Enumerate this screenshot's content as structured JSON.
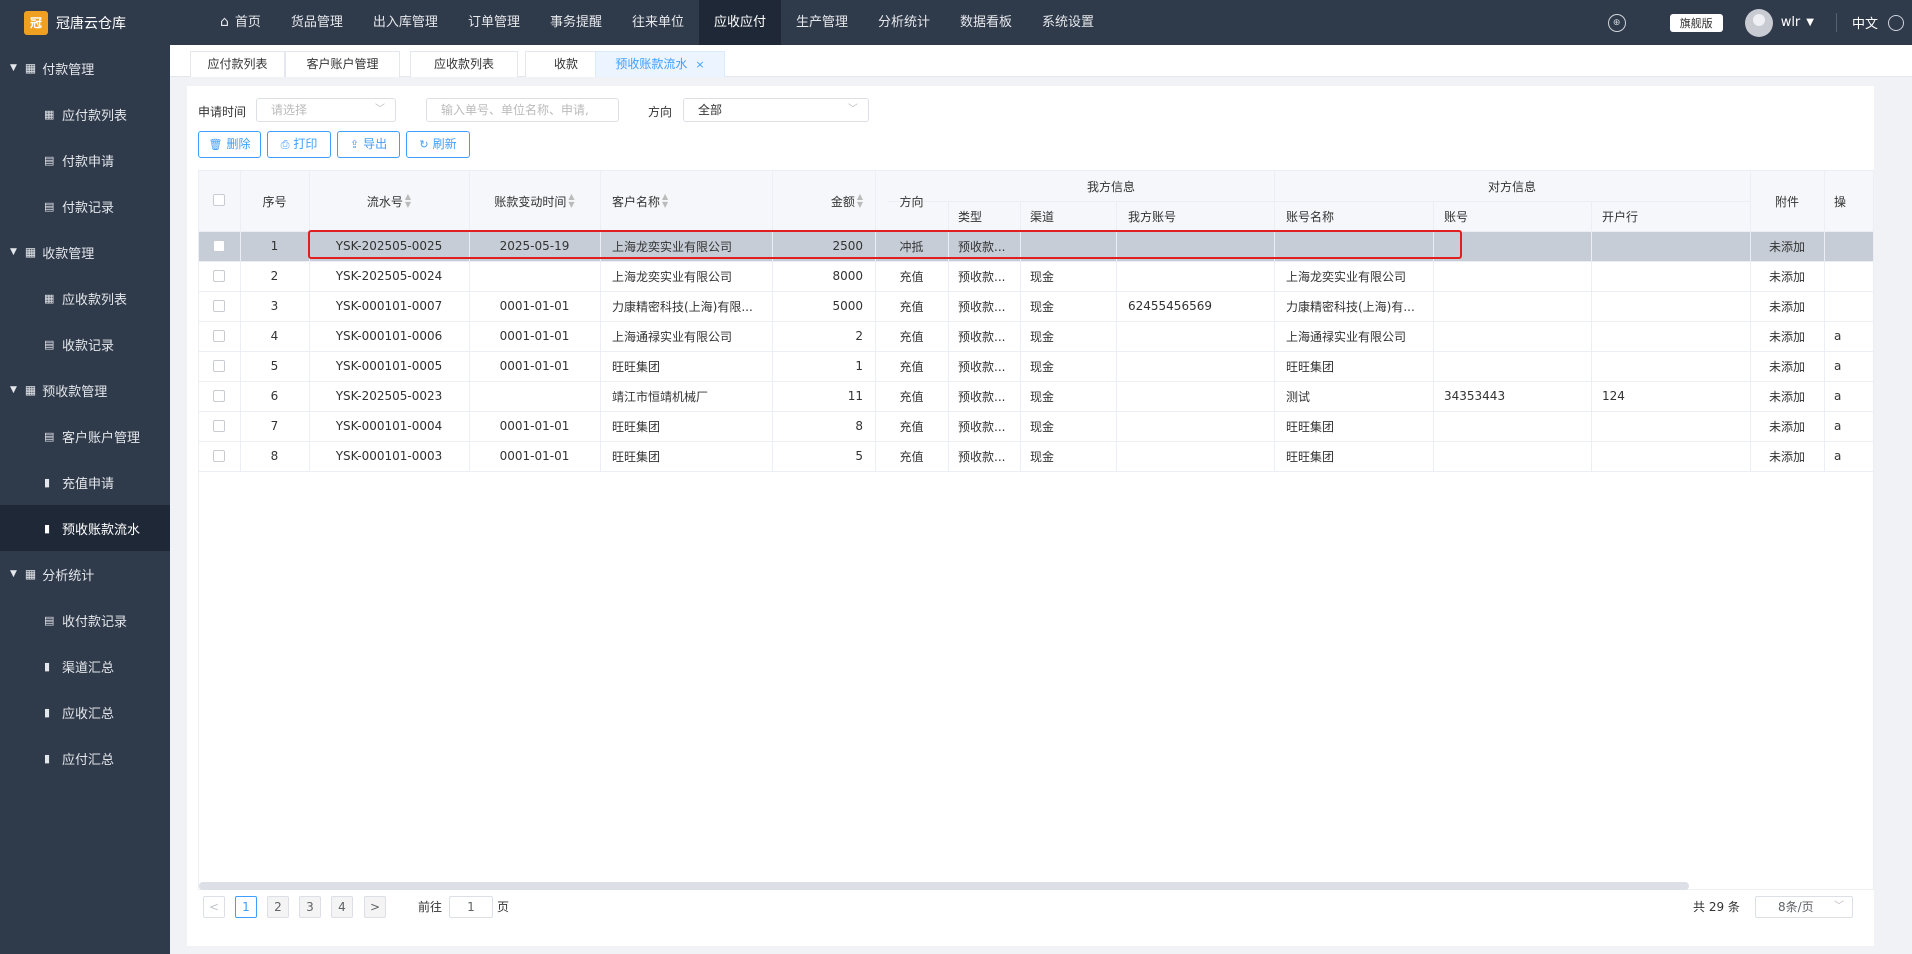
{
  "app": {
    "logo_text": "冠唐云仓库",
    "logo_mark": "冠"
  },
  "topnav": {
    "items": [
      {
        "label": "首页"
      },
      {
        "label": "货品管理"
      },
      {
        "label": "出入库管理"
      },
      {
        "label": "订单管理"
      },
      {
        "label": "事务提醒"
      },
      {
        "label": "往来单位"
      },
      {
        "label": "应收应付"
      },
      {
        "label": "生产管理"
      },
      {
        "label": "分析统计"
      },
      {
        "label": "数据看板"
      },
      {
        "label": "系统设置"
      }
    ],
    "active": "应收应付"
  },
  "header_right": {
    "edition": "旗舰版",
    "username": "wlr",
    "language": "中文"
  },
  "sidebar": {
    "groups": [
      {
        "label": "付款管理",
        "items": [
          {
            "label": "应付款列表",
            "icon": "grid-icon"
          },
          {
            "label": "付款申请",
            "icon": "document-icon"
          },
          {
            "label": "付款记录",
            "icon": "document-icon"
          }
        ]
      },
      {
        "label": "收款管理",
        "items": [
          {
            "label": "应收款列表",
            "icon": "grid-icon"
          },
          {
            "label": "收款记录",
            "icon": "document-icon"
          }
        ]
      },
      {
        "label": "预收款管理",
        "items": [
          {
            "label": "客户账户管理",
            "icon": "document-icon"
          },
          {
            "label": "充值申请",
            "icon": "bar-chart-icon"
          },
          {
            "label": "预收账款流水",
            "icon": "bar-chart-icon"
          }
        ]
      },
      {
        "label": "分析统计",
        "items": [
          {
            "label": "收付款记录",
            "icon": "document-icon"
          },
          {
            "label": "渠道汇总",
            "icon": "bar-chart-icon"
          },
          {
            "label": "应收汇总",
            "icon": "bar-chart-icon"
          },
          {
            "label": "应付汇总",
            "icon": "bar-chart-icon"
          }
        ]
      }
    ],
    "active_item": "预收账款流水"
  },
  "tabs": [
    {
      "label": "应付款列表"
    },
    {
      "label": "客户账户管理"
    },
    {
      "label": "应收款列表"
    },
    {
      "label": "收款"
    },
    {
      "label": "预收账款流水",
      "active": true,
      "close": "×"
    }
  ],
  "filters": {
    "apply_time_label": "申请时间",
    "apply_time_placeholder": "请选择",
    "search_placeholder": "输入单号、单位名称、申请,",
    "direction_label": "方向",
    "direction_value": "全部"
  },
  "toolbar": {
    "delete": "删除",
    "print": "打印",
    "export": "导出",
    "refresh": "刷新"
  },
  "table": {
    "headers": {
      "seq": "序号",
      "serial": "流水号",
      "change_time": "账款变动时间",
      "customer": "客户名称",
      "amount": "金额",
      "direction": "方向",
      "our_group": "我方信息",
      "our_type": "类型",
      "our_channel": "渠道",
      "our_account": "我方账号",
      "other_group": "对方信息",
      "other_account_name": "账号名称",
      "other_account": "账号",
      "other_bank": "开户行",
      "attachment": "附件",
      "extra": "操"
    },
    "rows": [
      {
        "seq": "1",
        "serial": "YSK-202505-0025",
        "time": "2025-05-19",
        "customer": "上海龙奕实业有限公司",
        "amount": "2500",
        "direction": "冲抵",
        "type": "预收款...",
        "channel": "",
        "our_account": "",
        "acc_name": "",
        "acc_no": "",
        "bank": "",
        "attach": "未添加",
        "extra": "",
        "selected": true
      },
      {
        "seq": "2",
        "serial": "YSK-202505-0024",
        "time": "",
        "customer": "上海龙奕实业有限公司",
        "amount": "8000",
        "direction": "充值",
        "type": "预收款...",
        "channel": "现金",
        "our_account": "",
        "acc_name": "上海龙奕实业有限公司",
        "acc_no": "",
        "bank": "",
        "attach": "未添加",
        "extra": ""
      },
      {
        "seq": "3",
        "serial": "YSK-000101-0007",
        "time": "0001-01-01",
        "customer": "力康精密科技(上海)有限...",
        "amount": "5000",
        "direction": "充值",
        "type": "预收款...",
        "channel": "现金",
        "our_account": "62455456569",
        "acc_name": "力康精密科技(上海)有...",
        "acc_no": "",
        "bank": "",
        "attach": "未添加",
        "extra": ""
      },
      {
        "seq": "4",
        "serial": "YSK-000101-0006",
        "time": "0001-01-01",
        "customer": "上海通禄实业有限公司",
        "amount": "2",
        "direction": "充值",
        "type": "预收款...",
        "channel": "现金",
        "our_account": "",
        "acc_name": "上海通禄实业有限公司",
        "acc_no": "",
        "bank": "",
        "attach": "未添加",
        "extra": "a"
      },
      {
        "seq": "5",
        "serial": "YSK-000101-0005",
        "time": "0001-01-01",
        "customer": "旺旺集团",
        "amount": "1",
        "direction": "充值",
        "type": "预收款...",
        "channel": "现金",
        "our_account": "",
        "acc_name": "旺旺集团",
        "acc_no": "",
        "bank": "",
        "attach": "未添加",
        "extra": "a"
      },
      {
        "seq": "6",
        "serial": "YSK-202505-0023",
        "time": "",
        "customer": "靖江市恒靖机械厂",
        "amount": "11",
        "direction": "充值",
        "type": "预收款...",
        "channel": "现金",
        "our_account": "",
        "acc_name": "测试",
        "acc_no": "34353443",
        "bank": "124",
        "attach": "未添加",
        "extra": "a"
      },
      {
        "seq": "7",
        "serial": "YSK-000101-0004",
        "time": "0001-01-01",
        "customer": "旺旺集团",
        "amount": "8",
        "direction": "充值",
        "type": "预收款...",
        "channel": "现金",
        "our_account": "",
        "acc_name": "旺旺集团",
        "acc_no": "",
        "bank": "",
        "attach": "未添加",
        "extra": "a"
      },
      {
        "seq": "8",
        "serial": "YSK-000101-0003",
        "time": "0001-01-01",
        "customer": "旺旺集团",
        "amount": "5",
        "direction": "充值",
        "type": "预收款...",
        "channel": "现金",
        "our_account": "",
        "acc_name": "旺旺集团",
        "acc_no": "",
        "bank": "",
        "attach": "未添加",
        "extra": "a"
      }
    ]
  },
  "pagination": {
    "prev": "<",
    "next": ">",
    "pages": [
      "1",
      "2",
      "3",
      "4"
    ],
    "current": "1",
    "goto_label": "前往",
    "goto_value": "1",
    "page_unit": "页",
    "total": "共 29 条",
    "page_size": "8条/页"
  },
  "colors": {
    "accent": "#409eff",
    "sidebar": "#2f3a4b",
    "highlight": "#e02020",
    "selected_row": "#c6cdd6"
  }
}
